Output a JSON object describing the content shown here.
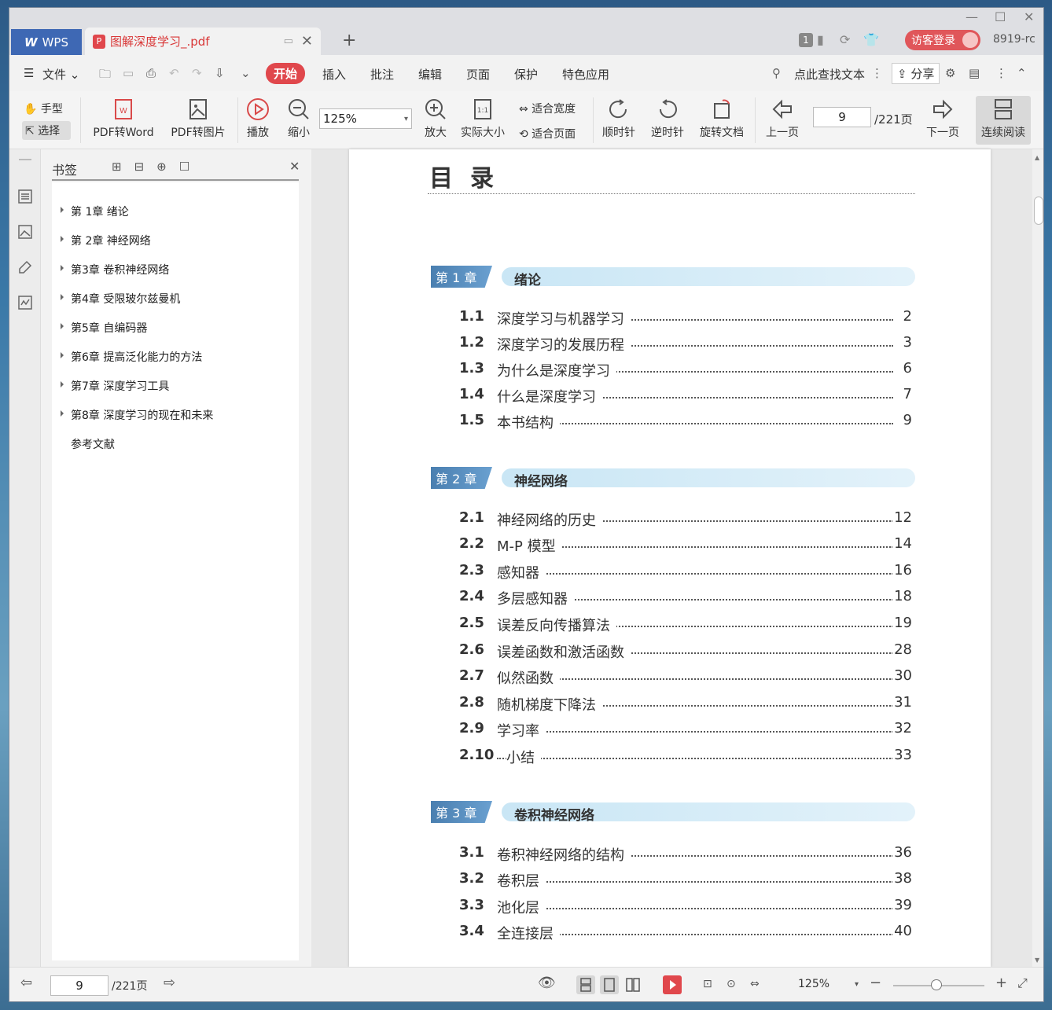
{
  "titlebar": {
    "app_tab": "WPS",
    "doc_tab": "图解深度学习_.pdf",
    "badge": "1",
    "login": "访客登录",
    "version": "8919-rc"
  },
  "menu": {
    "file": "文件",
    "items": [
      "开始",
      "插入",
      "批注",
      "编辑",
      "页面",
      "保护",
      "特色应用"
    ],
    "search": "点此查找文本",
    "share": "分享"
  },
  "toolbar": {
    "hand": "手型",
    "select": "选择",
    "pdf2word": "PDF转Word",
    "pdf2img": "PDF转图片",
    "play": "播放",
    "zoomout": "缩小",
    "zoom_value": "125%",
    "zoomin": "放大",
    "actual": "实际大小",
    "fit_width": "适合宽度",
    "fit_page": "适合页面",
    "cw": "顺时针",
    "ccw": "逆时针",
    "rotate": "旋转文档",
    "prev": "上一页",
    "page_value": "9",
    "page_total": "/221页",
    "next": "下一页",
    "continuous": "连续阅读"
  },
  "bookmarks": {
    "title": "书签",
    "items": [
      {
        "label": "第 1章 绪论",
        "expandable": true
      },
      {
        "label": "第 2章 神经网络",
        "expandable": true
      },
      {
        "label": "第3章 卷积神经网络",
        "expandable": true
      },
      {
        "label": "第4章 受限玻尔兹曼机",
        "expandable": true
      },
      {
        "label": "第5章 自编码器",
        "expandable": true
      },
      {
        "label": "第6章 提高泛化能力的方法",
        "expandable": true
      },
      {
        "label": "第7章 深度学习工具",
        "expandable": true
      },
      {
        "label": "第8章 深度学习的现在和未来",
        "expandable": true
      },
      {
        "label": "参考文献",
        "expandable": false
      }
    ]
  },
  "doc": {
    "title": "目录",
    "chapters": [
      {
        "label": "第 1 章",
        "name": "绪论",
        "entries": [
          {
            "num": "1.1",
            "text": "深度学习与机器学习",
            "page": "2"
          },
          {
            "num": "1.2",
            "text": "深度学习的发展历程",
            "page": "3"
          },
          {
            "num": "1.3",
            "text": "为什么是深度学习",
            "page": "6"
          },
          {
            "num": "1.4",
            "text": "什么是深度学习",
            "page": "7"
          },
          {
            "num": "1.5",
            "text": "本书结构",
            "page": "9"
          }
        ]
      },
      {
        "label": "第 2 章",
        "name": "神经网络",
        "entries": [
          {
            "num": "2.1",
            "text": "神经网络的历史",
            "page": "12"
          },
          {
            "num": "2.2",
            "text": "M-P 模型",
            "page": "14"
          },
          {
            "num": "2.3",
            "text": "感知器",
            "page": "16"
          },
          {
            "num": "2.4",
            "text": "多层感知器",
            "page": "18"
          },
          {
            "num": "2.5",
            "text": "误差反向传播算法",
            "page": "19"
          },
          {
            "num": "2.6",
            "text": "误差函数和激活函数",
            "page": "28"
          },
          {
            "num": "2.7",
            "text": "似然函数",
            "page": "30"
          },
          {
            "num": "2.8",
            "text": "随机梯度下降法",
            "page": "31"
          },
          {
            "num": "2.9",
            "text": "学习率",
            "page": "32"
          },
          {
            "num": "2.10",
            "text": "小结",
            "page": "33"
          }
        ]
      },
      {
        "label": "第 3 章",
        "name": "卷积神经网络",
        "entries": [
          {
            "num": "3.1",
            "text": "卷积神经网络的结构",
            "page": "36"
          },
          {
            "num": "3.2",
            "text": "卷积层",
            "page": "38"
          },
          {
            "num": "3.3",
            "text": "池化层",
            "page": "39"
          },
          {
            "num": "3.4",
            "text": "全连接层",
            "page": "40"
          }
        ]
      }
    ]
  },
  "status": {
    "page_value": "9",
    "page_total": "/221页",
    "zoom": "125%"
  }
}
